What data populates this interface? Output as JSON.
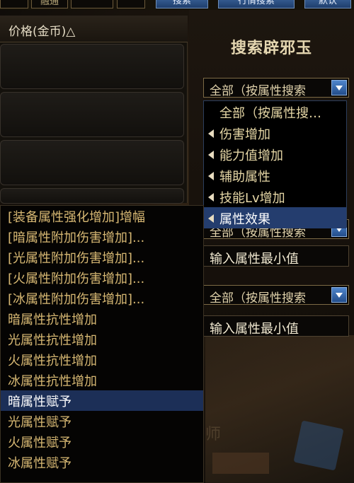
{
  "top": {
    "cell_label": "融通",
    "buttons": [
      "搜索",
      "行情搜索",
      "默认"
    ]
  },
  "results": {
    "price_header": "价格(金币)△"
  },
  "search": {
    "title": "搜索辟邪玉",
    "combo1_value": "全部（按属性搜索",
    "combo2_value": "全部（按属性搜索",
    "combo3_value": "全部（按属性搜索",
    "input1_text": "输入属性最小值",
    "input2_text": "输入属性最小值"
  },
  "category_menu": {
    "items": [
      {
        "label": "全部（按属性搜…",
        "arrow": false
      },
      {
        "label": "伤害增加",
        "arrow": true
      },
      {
        "label": "能力值增加",
        "arrow": true
      },
      {
        "label": "辅助属性",
        "arrow": true
      },
      {
        "label": "技能Lv增加",
        "arrow": true
      },
      {
        "label": "属性效果",
        "arrow": true,
        "selected": true
      }
    ]
  },
  "attribute_menu": {
    "items": [
      "[装备属性强化增加]增幅",
      "[暗属性附加伤害增加]...",
      "[光属性附加伤害增加]...",
      "[火属性附加伤害增加]...",
      "[冰属性附加伤害增加]...",
      "暗属性抗性增加",
      "光属性抗性增加",
      "火属性抗性增加",
      "冰属性抗性增加",
      "暗属性赋予",
      "光属性赋予",
      "火属性赋予",
      "冰属性赋予"
    ],
    "selected_index": 9
  },
  "background_text": "师",
  "colors": {
    "accent_blue": "#243d6e",
    "gold_text": "#d7b873",
    "selection": "#1c2f57"
  }
}
